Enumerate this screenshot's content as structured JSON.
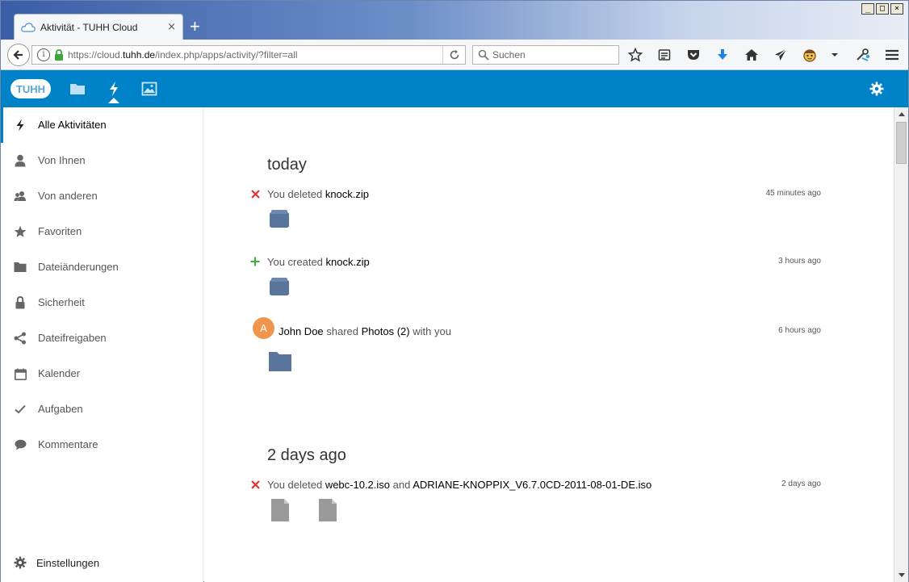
{
  "window": {
    "controls": [
      "_",
      "□",
      "×"
    ]
  },
  "browser": {
    "tab_title": "Aktivität - TUHH Cloud",
    "tab_close": "×",
    "new_tab": "+",
    "url_prefix": "https://cloud.",
    "url_domain": "tuhh.de",
    "url_path": "/index.php/apps/activity/?filter=all",
    "search_placeholder": "Suchen",
    "toolbar_icons": [
      "star-icon",
      "reading-list-icon",
      "pocket-icon",
      "download-icon",
      "home-icon",
      "send-icon",
      "addon-face-icon",
      "dropdown-icon",
      "tools-icon",
      "menu-icon"
    ]
  },
  "app": {
    "logo_text": "TUHH",
    "accent_color": "#0082c9",
    "header_icons": [
      "files-icon",
      "activity-icon",
      "gallery-icon",
      "settings-icon"
    ]
  },
  "sidebar": {
    "items": [
      {
        "label": "Alle Aktivitäten",
        "icon": "lightning-icon",
        "active": true
      },
      {
        "label": "Von Ihnen",
        "icon": "person-icon"
      },
      {
        "label": "Von anderen",
        "icon": "people-icon"
      },
      {
        "label": "Favoriten",
        "icon": "star-icon"
      },
      {
        "label": "Dateiänderungen",
        "icon": "folder-icon"
      },
      {
        "label": "Sicherheit",
        "icon": "lock-icon"
      },
      {
        "label": "Dateifreigaben",
        "icon": "share-icon"
      },
      {
        "label": "Kalender",
        "icon": "calendar-icon"
      },
      {
        "label": "Aufgaben",
        "icon": "checkmark-icon"
      },
      {
        "label": "Kommentare",
        "icon": "comment-icon"
      }
    ],
    "settings_label": "Einstellungen"
  },
  "activity": {
    "sections": [
      {
        "title": "today",
        "items": [
          {
            "type": "deleted",
            "pre": "You deleted ",
            "object": "knock.zip",
            "post": "",
            "time": "45 minutes ago",
            "thumb": "package-icon"
          },
          {
            "type": "created",
            "pre": "You created ",
            "object": "knock.zip",
            "post": "",
            "time": "3 hours ago",
            "thumb": "package-icon"
          },
          {
            "type": "shared",
            "avatar": "A",
            "user": "John Doe",
            "pre": " shared ",
            "object": "Photos (2)",
            "post": " with you",
            "time": "6 hours ago",
            "thumb": "folder-icon"
          }
        ]
      },
      {
        "title": "2 days ago",
        "items": [
          {
            "type": "deleted",
            "pre": "You deleted ",
            "object": "webc-10.2.iso",
            "mid": " and ",
            "object2": "ADRIANE-KNOPPIX_V6.7.0CD-2011-08-01-DE.iso",
            "time": "2 days ago",
            "thumb": "file-icon"
          }
        ]
      }
    ]
  }
}
